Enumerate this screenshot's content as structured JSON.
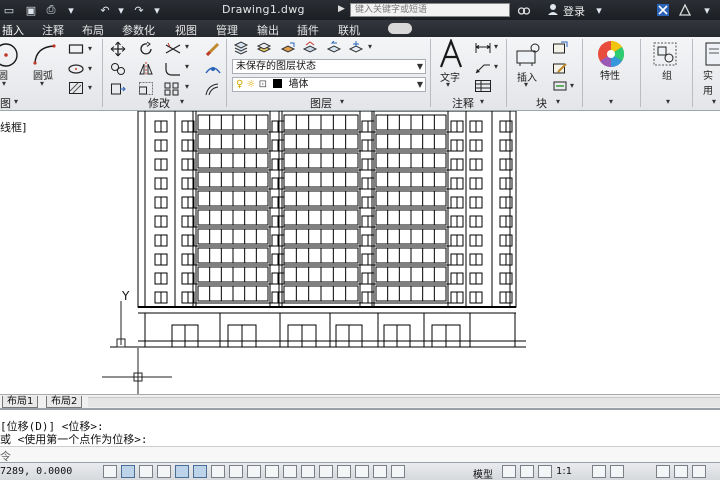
{
  "app": {
    "title": "Drawing1.dwg",
    "search_placeholder": "键入关键字或短语",
    "login": "登录"
  },
  "tabs": [
    {
      "label": "插入"
    },
    {
      "label": "注释"
    },
    {
      "label": "布局"
    },
    {
      "label": "参数化"
    },
    {
      "label": "视图"
    },
    {
      "label": "管理"
    },
    {
      "label": "输出"
    },
    {
      "label": "插件"
    },
    {
      "label": "联机"
    }
  ],
  "ribbon": {
    "draw": {
      "circle_label": "圆",
      "arc_label": "圆弧",
      "panel_label": "图"
    },
    "modify": {
      "panel_label": "修改"
    },
    "layers": {
      "panel_label": "图层",
      "layer_state": "未保存的图层状态",
      "current_layer": "墙体",
      "current_layer_color": "#000000"
    },
    "annotation": {
      "text_label": "文字",
      "panel_label": "注释"
    },
    "block": {
      "insert_label": "插入",
      "panel_label": "块"
    },
    "properties": {
      "label": "特性"
    },
    "groups": {
      "label": "组"
    },
    "utilities": {
      "label": "实用"
    }
  },
  "canvas": {
    "prompt_fragment": "线框]",
    "ucs_y_label": "Y"
  },
  "layout_tabs": [
    {
      "label": "布局1"
    },
    {
      "label": "布局2"
    }
  ],
  "command": {
    "line1": "[位移(D)] <位移>:",
    "line2": "或 <使用第一个点作为位移>:",
    "prompt": "令"
  },
  "status": {
    "coords": "7289, 0.0000",
    "model": "模型",
    "scale": "1:1"
  },
  "colors": {
    "titlebar": "#1f2226",
    "ribbon": "#eceef1",
    "drawing_lines": "#000000"
  }
}
